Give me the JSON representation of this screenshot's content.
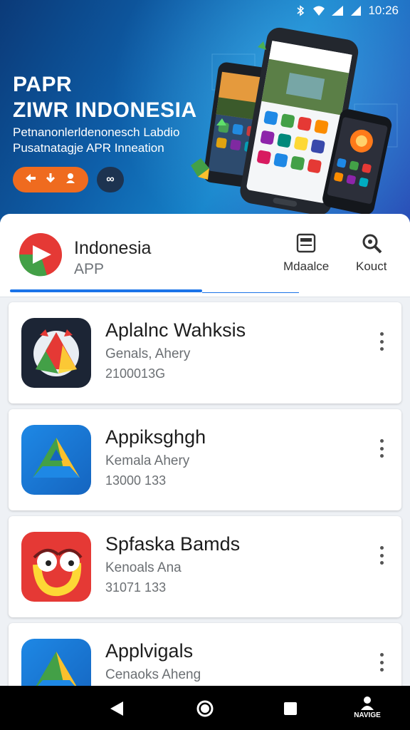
{
  "status_bar": {
    "time": "10:26"
  },
  "hero": {
    "title_line1": "PAPR",
    "title_line2": "ZIWR INDONESIA",
    "subtitle_line1": "Petnanonlerldenonesch Labdio",
    "subtitle_line2": "Pusatnatagje APR Inneation",
    "cta_icons": [
      "share-icon",
      "download-icon",
      "person-icon"
    ],
    "more_label": "∞"
  },
  "app_header": {
    "name": "Indonesia",
    "subtitle": "APP",
    "actions": [
      {
        "label": "Mdaalce",
        "icon": "document-icon"
      },
      {
        "label": "Kouct",
        "icon": "search-icon"
      }
    ]
  },
  "app_list": [
    {
      "title": "Aplalnc Wahksis",
      "developer": "Genals, Ahery",
      "meta": "2100013G",
      "icon": "drive-like-dark-icon"
    },
    {
      "title": "Appiksghgh",
      "developer": "Kemala Ahery",
      "meta": "13000 133",
      "icon": "drive-icon"
    },
    {
      "title": "Spfaska Bamds",
      "developer": "Kenoals Ana",
      "meta": "31071 133",
      "icon": "face-icon"
    },
    {
      "title": "Applvigals",
      "developer": "Cenaoks Aheng",
      "meta": "",
      "icon": "drive-icon"
    }
  ],
  "nav": {
    "back": "back-icon",
    "home": "home-icon",
    "recents": "recents-icon",
    "user_label": "NAVIGE"
  },
  "colors": {
    "accent": "#1a73e8",
    "cta": "#ef6b1f",
    "hero_start": "#0b3a78",
    "hero_end": "#2b4fb8"
  }
}
